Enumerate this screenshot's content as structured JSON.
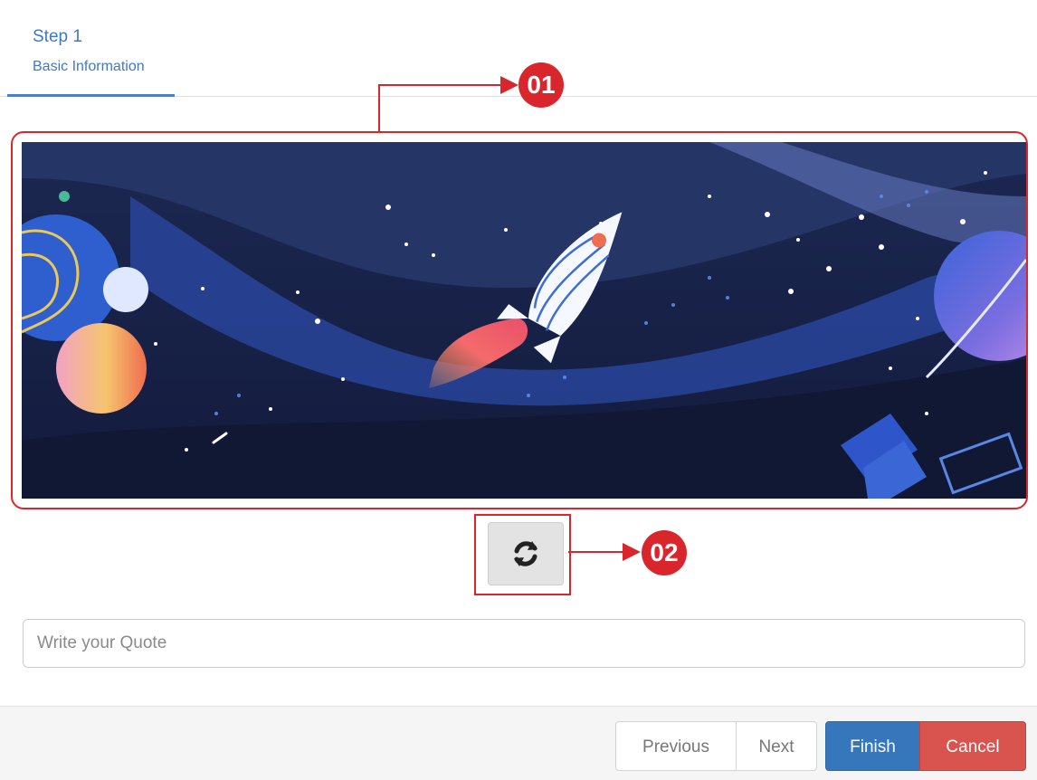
{
  "wizard": {
    "step_title": "Step 1",
    "step_subtitle": "Basic Information"
  },
  "banner": {
    "image_name": "space-rocket-illustration"
  },
  "callouts": {
    "first": "01",
    "second": "02"
  },
  "refresh": {
    "icon": "refresh-icon"
  },
  "quote": {
    "placeholder": "Write your Quote",
    "value": ""
  },
  "footer": {
    "previous_label": "Previous",
    "next_label": "Next",
    "finish_label": "Finish",
    "cancel_label": "Cancel"
  },
  "colors": {
    "accent": "#3d78c9",
    "annotation": "#d9262c",
    "finish": "#3677bb",
    "cancel": "#d9534f"
  }
}
